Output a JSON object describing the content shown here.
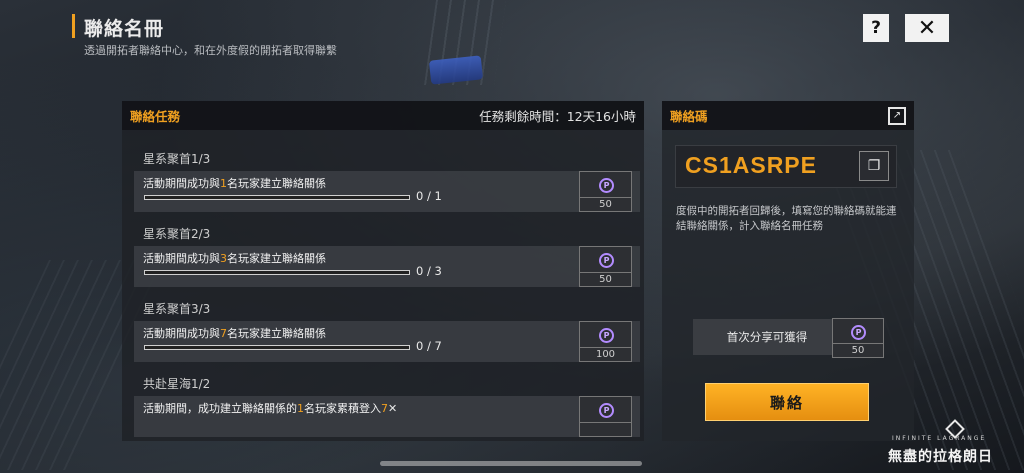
{
  "header": {
    "title": "聯絡名冊",
    "subtitle": "透過開拓者聯絡中心，和在外度假的開拓者取得聯繫",
    "help_label": "?",
    "close_label": "✕"
  },
  "missions": {
    "heading": "聯絡任務",
    "remaining_label": "任務剩餘時間：12天16小時",
    "tasks": [
      {
        "name": "星系聚首1/3",
        "desc_pre": "活動期間成功與",
        "desc_num": "1",
        "desc_post": "名玩家建立聯絡關係",
        "progress_text": "0 / 1",
        "progress": 0,
        "reward": "50"
      },
      {
        "name": "星系聚首2/3",
        "desc_pre": "活動期間成功與",
        "desc_num": "3",
        "desc_post": "名玩家建立聯絡關係",
        "progress_text": "0 / 3",
        "progress": 0,
        "reward": "50"
      },
      {
        "name": "星系聚首3/3",
        "desc_pre": "活動期間成功與",
        "desc_num": "7",
        "desc_post": "名玩家建立聯絡關係",
        "progress_text": "0 / 7",
        "progress": 0,
        "reward": "100"
      },
      {
        "name": "共赴星海1/2",
        "desc_pre": "活動期間，成功建立聯絡關係的",
        "desc_num": "1",
        "desc_post": "名玩家累積登入",
        "desc_num2": "7",
        "progress_text": "",
        "progress": 0,
        "reward": ""
      }
    ]
  },
  "contact": {
    "heading": "聯絡碼",
    "code": "CS1ASRPE",
    "description": "度假中的開拓者回歸後，填寫您的聯絡碼就能連結聯絡關係，計入聯絡名冊任務",
    "share_label": "首次分享可獲得",
    "share_reward": "50",
    "button_label": "聯絡"
  },
  "logo": {
    "en": "INFINITE LAGRANGE",
    "cn": "無盡的拉格朗日"
  },
  "colors": {
    "accent": "#f0a020",
    "currency": "#b38cff"
  },
  "icons": {
    "currency": "p-coin-icon",
    "export": "export-icon",
    "copy": "copy-icon",
    "close": "close-icon",
    "help": "help-icon"
  }
}
